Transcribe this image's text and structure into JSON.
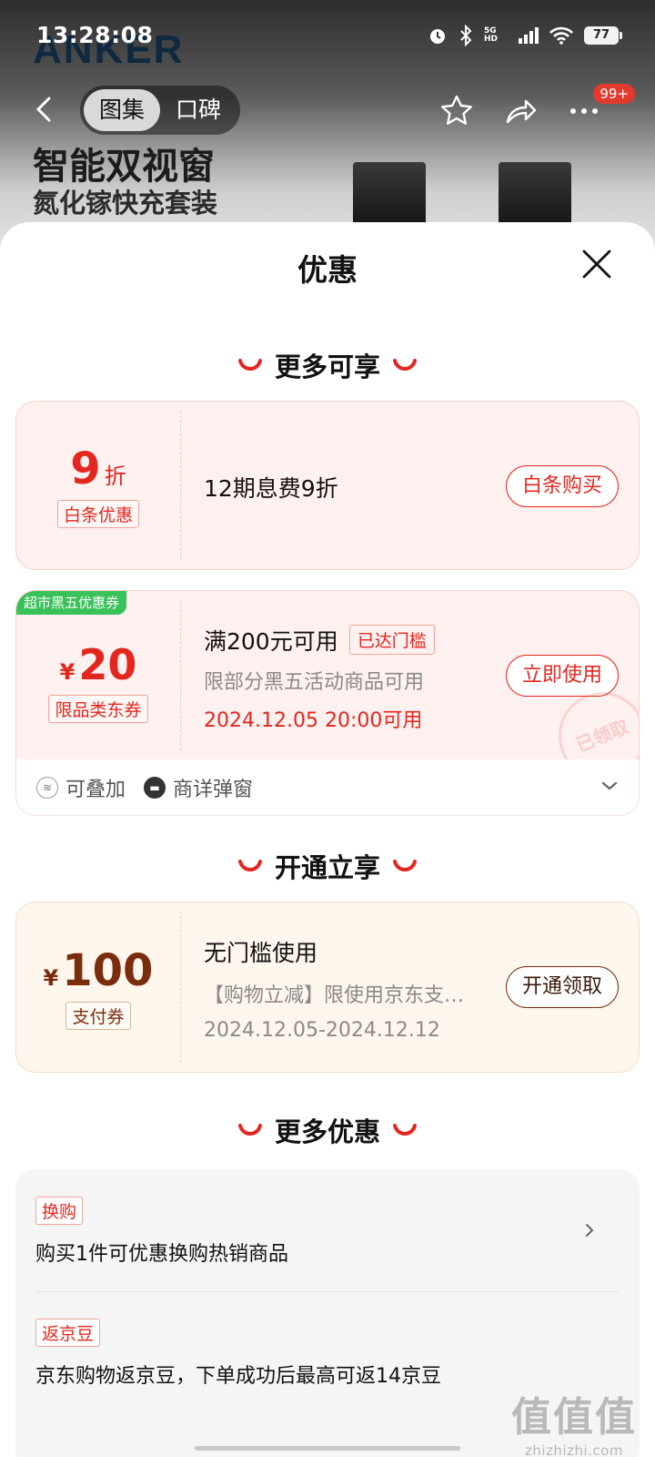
{
  "status_bar": {
    "time": "13:28:08",
    "network": "5G HD",
    "battery": "77"
  },
  "background": {
    "brand_logo": "ANKER",
    "tabs": [
      {
        "label": "图集",
        "active": true
      },
      {
        "label": "口碑",
        "active": false
      }
    ],
    "cart_badge": "99+",
    "promo_line1": "智能双视窗",
    "promo_line2": "氮化镓快充套装"
  },
  "sheet": {
    "title": "优惠",
    "sections": {
      "more_enjoy": "更多可享",
      "activate": "开通立享",
      "more_offers": "更多优惠"
    },
    "baitiao_card": {
      "value": "9",
      "unit": "折",
      "tag": "白条优惠",
      "main": "12期息费9折",
      "button": "白条购买"
    },
    "coupon_card": {
      "corner_badge": "超市黑五优惠券",
      "currency": "¥",
      "value": "20",
      "tag": "限品类东券",
      "main": "满200元可用",
      "threshold_tag": "已达门槛",
      "sub": "限部分黑五活动商品可用",
      "date": "2024.12.05 20:00可用",
      "button": "立即使用",
      "stamp": "已领取",
      "footer": {
        "stackable": "可叠加",
        "popup": "商详弹窗"
      }
    },
    "pay_card": {
      "currency": "¥",
      "value": "100",
      "tag": "支付券",
      "main": "无门槛使用",
      "sub": "【购物立减】限使用京东支…",
      "date": "2024.12.05-2024.12.12",
      "button": "开通领取"
    },
    "more_items": [
      {
        "tag": "换购",
        "text": "购买1件可优惠换购热销商品"
      },
      {
        "tag": "返京豆",
        "text": "京东购物返京豆，下单成功后最高可返14京豆"
      }
    ]
  },
  "watermark": {
    "glyphs": "值值值",
    "url": "zhizhizhi.com"
  },
  "colors": {
    "accent_red": "#e3271f",
    "coupon_bg": "#fff1ef",
    "pay_bg": "#fff6ee",
    "pay_brown": "#7a2d0c",
    "green_badge": "#39c15a"
  }
}
